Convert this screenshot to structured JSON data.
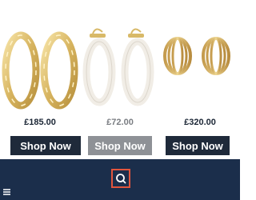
{
  "products": [
    {
      "price": "£185.00",
      "shop_label": "Shop Now",
      "image": "gold-twisted-hoop-earrings"
    },
    {
      "price": "£72.00",
      "shop_label": "Shop Now",
      "image": "white-hoop-earrings"
    },
    {
      "price": "£320.00",
      "shop_label": "Shop Now",
      "image": "gold-ribbed-huggie-earrings"
    }
  ],
  "footer": {
    "search_icon": "search-icon",
    "menu_icon": "menu-icon"
  },
  "colors": {
    "button_dark": "#1f2a3a",
    "button_muted": "#8e9196",
    "footer_bg": "#1b2e4b",
    "focus_outline": "#e2553d"
  }
}
